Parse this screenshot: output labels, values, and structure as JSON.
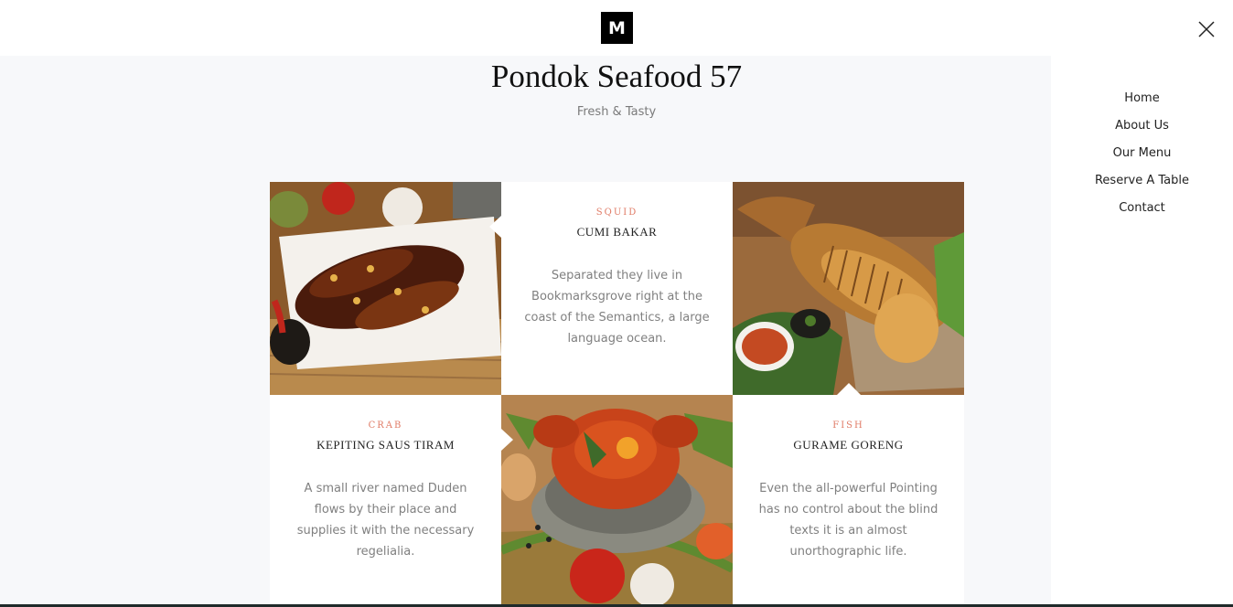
{
  "brand": {
    "logo_letter": "M"
  },
  "hero": {
    "title": "Pondok Seafood 57",
    "subtitle": "Fresh & Tasty"
  },
  "nav": {
    "items": [
      "Home",
      "About Us",
      "Our Menu",
      "Reserve A Table",
      "Contact"
    ]
  },
  "menu": {
    "items": [
      {
        "category": "SQUID",
        "name": "CUMI BAKAR",
        "description": "Separated they live in Bookmarksgrove right at the coast of the Semantics, a large language ocean."
      },
      {
        "category": "CRAB",
        "name": "KEPITING SAUS TIRAM",
        "description": "A small river named Duden flows by their place and supplies it with the necessary regelialia."
      },
      {
        "category": "FISH",
        "name": "GURAME GORENG",
        "description": "Even the all-powerful Pointing has no control about the blind texts it is an almost unorthographic life."
      }
    ]
  },
  "icons": {
    "close": "close-icon"
  },
  "colors": {
    "accent": "#e07b66",
    "content_bg": "#f7f8fa",
    "logo_bg": "#000000"
  }
}
